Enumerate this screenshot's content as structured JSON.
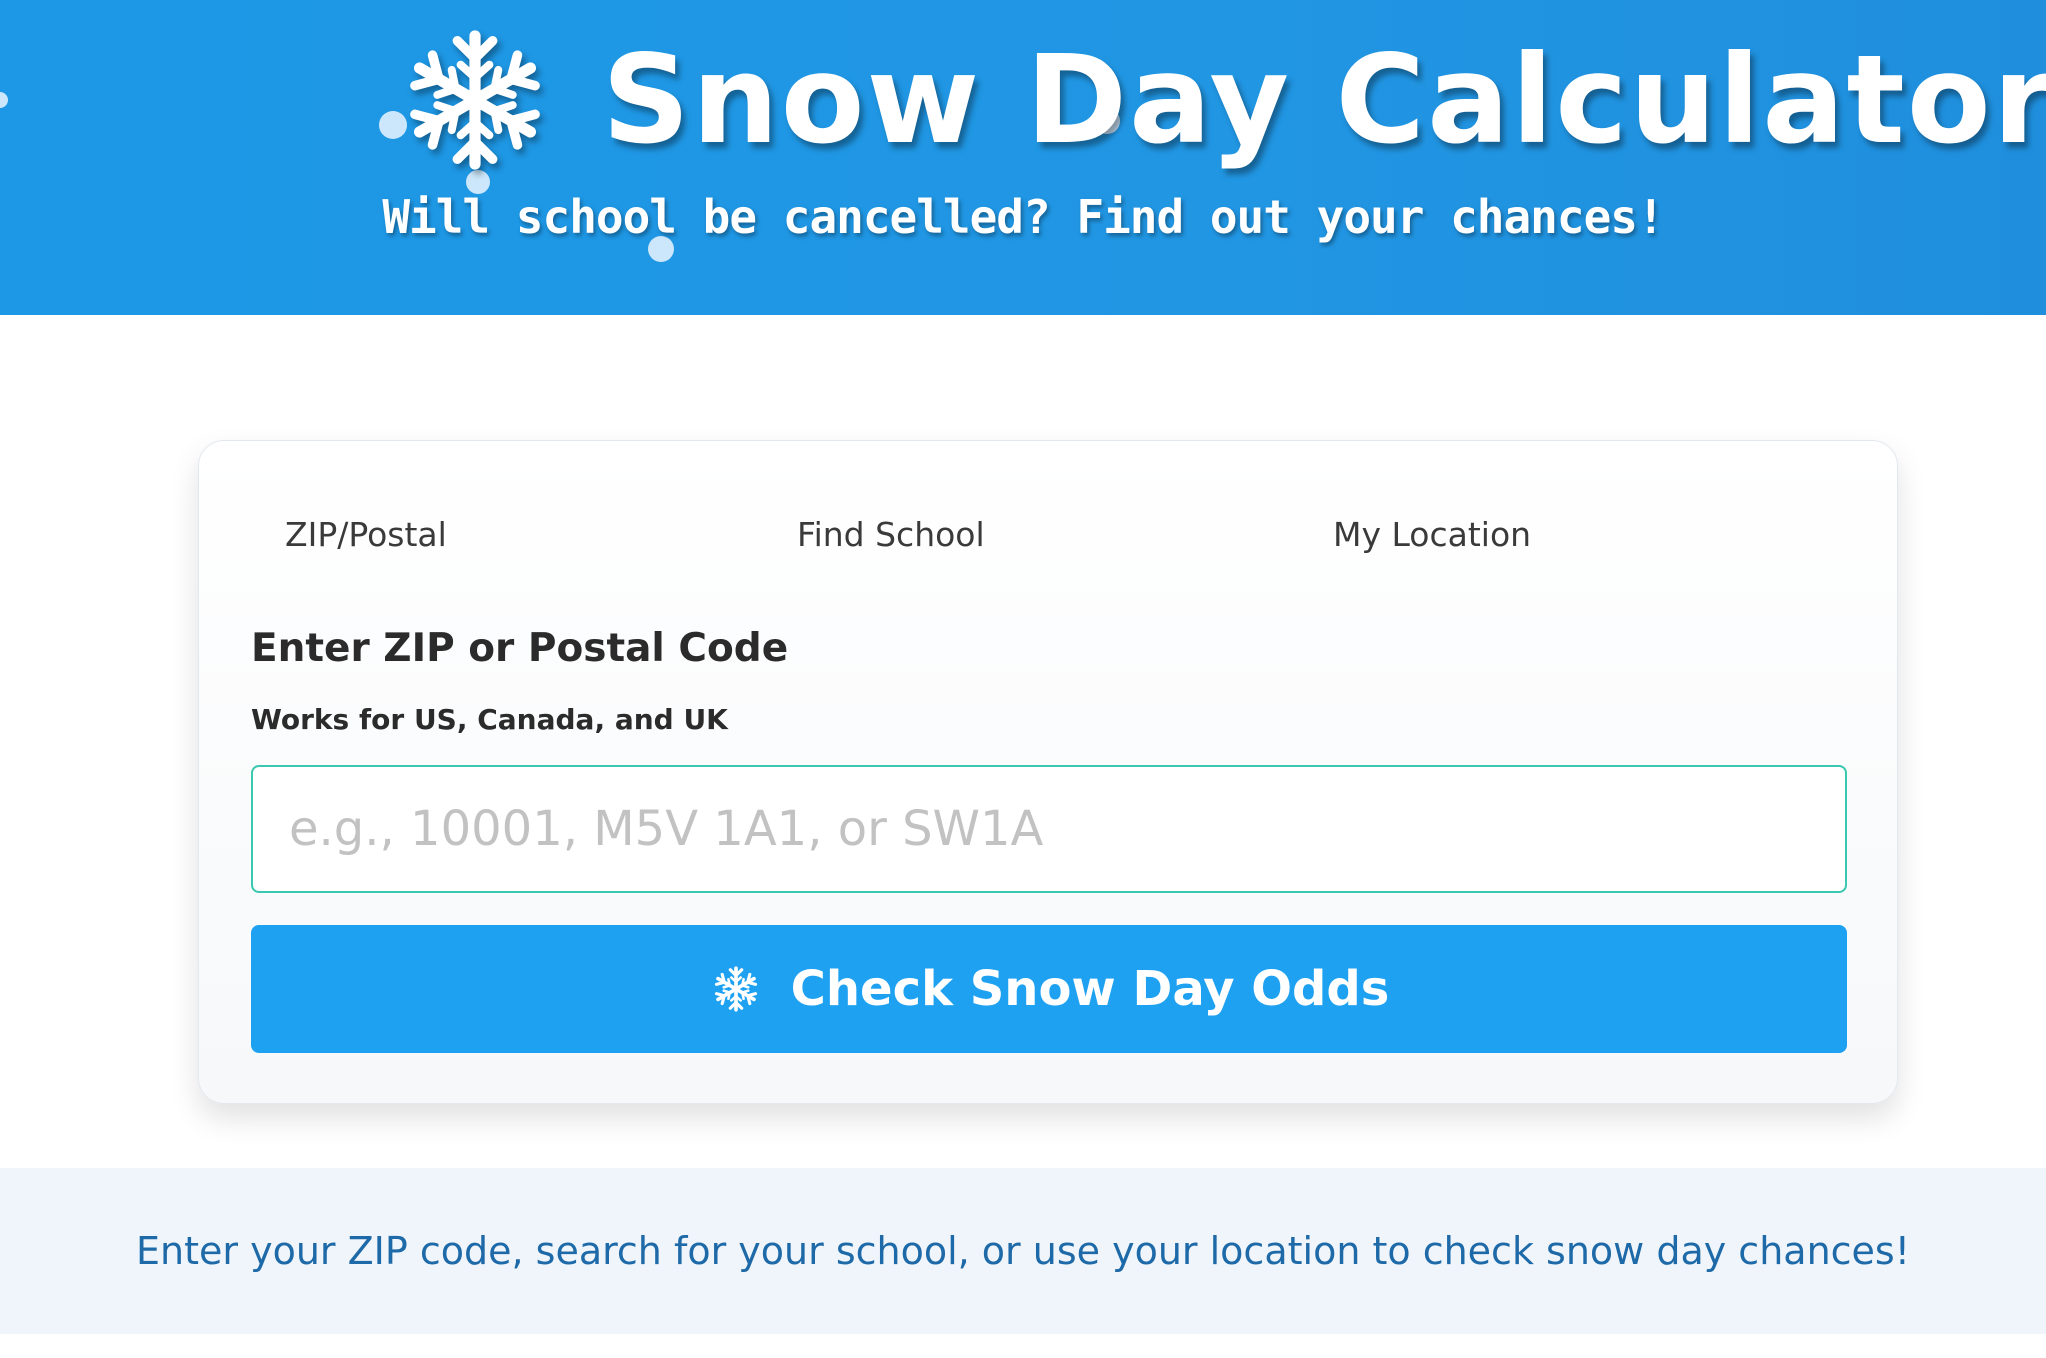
{
  "header": {
    "title": "Snow Day Calculator",
    "subtitle": "Will school be cancelled? Find out your chances!",
    "logo_icon": "snowflake-icon",
    "background_color": "#1c98e6"
  },
  "tabs": [
    {
      "label": "ZIP/Postal"
    },
    {
      "label": "Find School"
    },
    {
      "label": "My Location"
    }
  ],
  "zip_section": {
    "title": "Enter ZIP or Postal Code",
    "subtitle": "Works for US, Canada, and UK",
    "input_value": "",
    "input_placeholder": "e.g., 10001, M5V 1A1, or SW1A",
    "button_label": "Check Snow Day Odds",
    "button_icon": "snowflake-icon",
    "button_color": "#1ea1f1",
    "input_border_color": "#3ac8b0"
  },
  "footer": {
    "message": "Enter your ZIP code, search for your school, or use your location to check snow day chances!",
    "text_color": "#1e6aa8"
  }
}
